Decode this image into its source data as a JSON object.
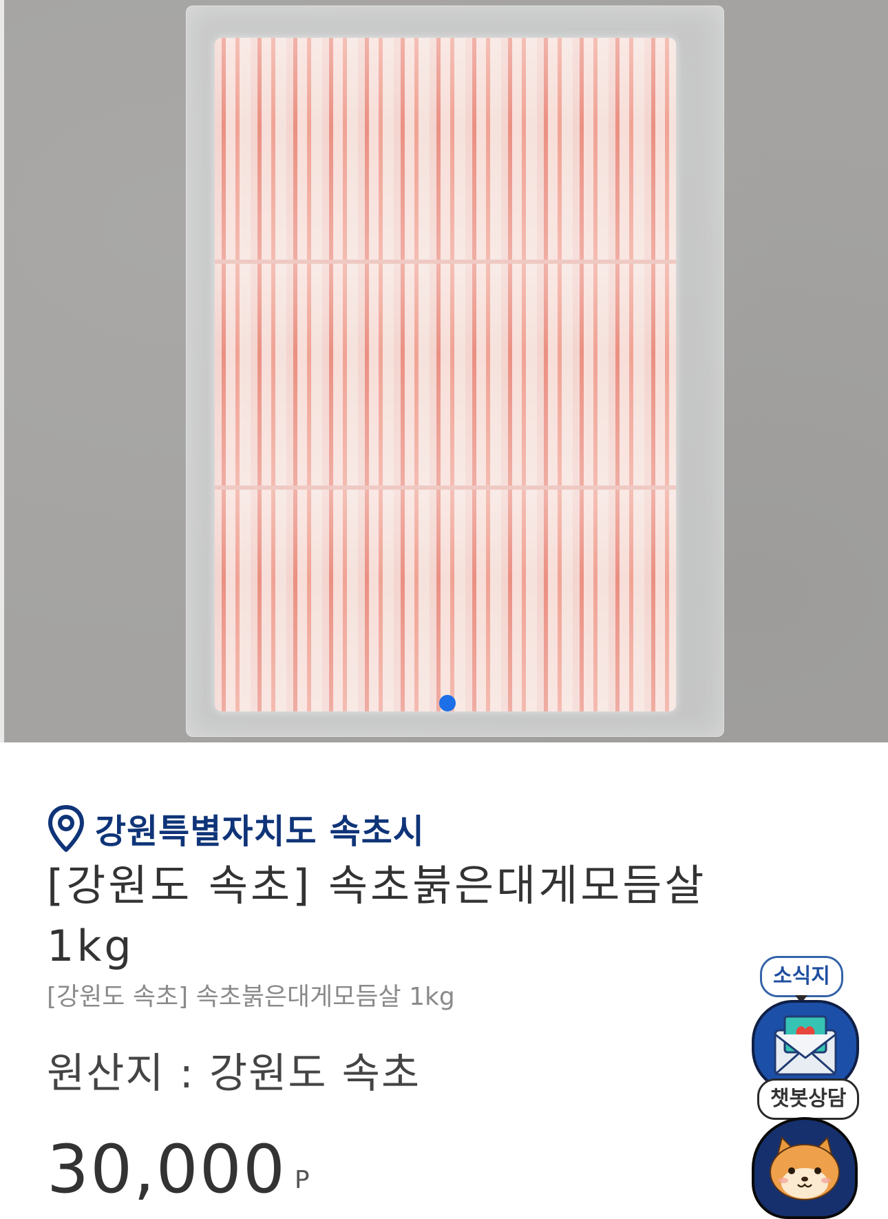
{
  "product_image": {
    "alt": "",
    "carousel": {
      "total": 1,
      "active": 1
    }
  },
  "location": {
    "icon": "location-pin-icon",
    "text": "강원특별자치도 속초시"
  },
  "product": {
    "title": "[강원도 속초] 속초붉은대게모듬살 1kg",
    "subtitle": "[강원도 속초] 속초붉은대게모듬살 1kg",
    "origin": "원산지 : 강원도 속초",
    "price": "30,000",
    "price_unit": "P"
  },
  "floating": {
    "news": {
      "label": "소식지",
      "icon": "envelope-heart-icon"
    },
    "chatbot": {
      "label": "챗봇상담",
      "icon": "cat-mascot-icon"
    }
  },
  "colors": {
    "accent_blue": "#1c6fe6",
    "location_navy": "#0f3478",
    "news_blue": "#1c4fa8",
    "chat_navy": "#16306d"
  }
}
